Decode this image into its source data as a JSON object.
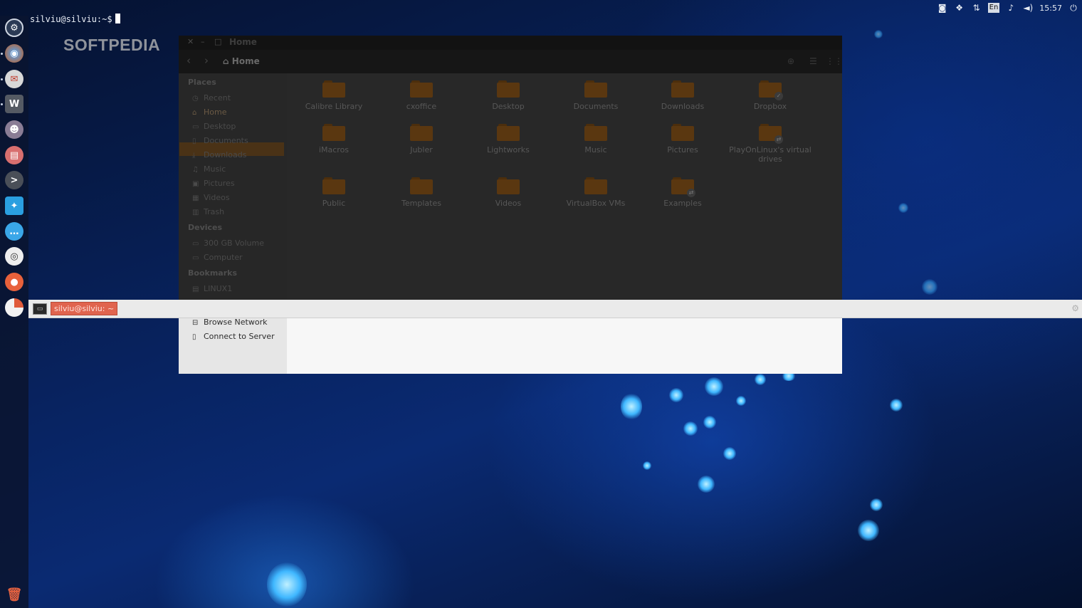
{
  "terminal": {
    "prompt": "silviu@silviu:~$"
  },
  "tray": {
    "items": [
      {
        "name": "terminal-indicator-icon",
        "glyph": "◙"
      },
      {
        "name": "dropbox-icon",
        "glyph": "❖"
      },
      {
        "name": "network-icon",
        "glyph": "⇅"
      },
      {
        "name": "keyboard-layout",
        "text": "En"
      },
      {
        "name": "notification-icon",
        "glyph": "♪"
      },
      {
        "name": "volume-icon",
        "glyph": "◄)"
      }
    ],
    "clock": "15:57",
    "power_glyph": "⏻"
  },
  "watermark": "SOFTPEDIA",
  "file_manager": {
    "title": "Home",
    "breadcrumb": "Home",
    "sidebar": {
      "places_header": "Places",
      "places": [
        "Recent",
        "Home",
        "Desktop",
        "Documents",
        "Downloads",
        "Music",
        "Pictures",
        "Videos",
        "Trash"
      ],
      "devices_header": "Devices",
      "devices": [
        "300 GB Volume",
        "Computer"
      ],
      "bookmarks_header": "Bookmarks",
      "bookmarks": [
        "LINUX1"
      ],
      "network": [
        "Browse Network",
        "Connect to Server"
      ]
    },
    "folders": [
      "Calibre Library",
      "cxoffice",
      "Desktop",
      "Documents",
      "Downloads",
      "Dropbox",
      "iMacros",
      "Jubler",
      "Lightworks",
      "Music",
      "Pictures",
      "PlayOnLinux's virtual drives",
      "Public",
      "Templates",
      "Videos",
      "VirtualBox VMs",
      "Examples"
    ]
  },
  "terminal_panel": {
    "task_label": "silviu@silviu: ~"
  },
  "colors": {
    "highlight": "#e0644e",
    "folder": "#5a3710"
  }
}
